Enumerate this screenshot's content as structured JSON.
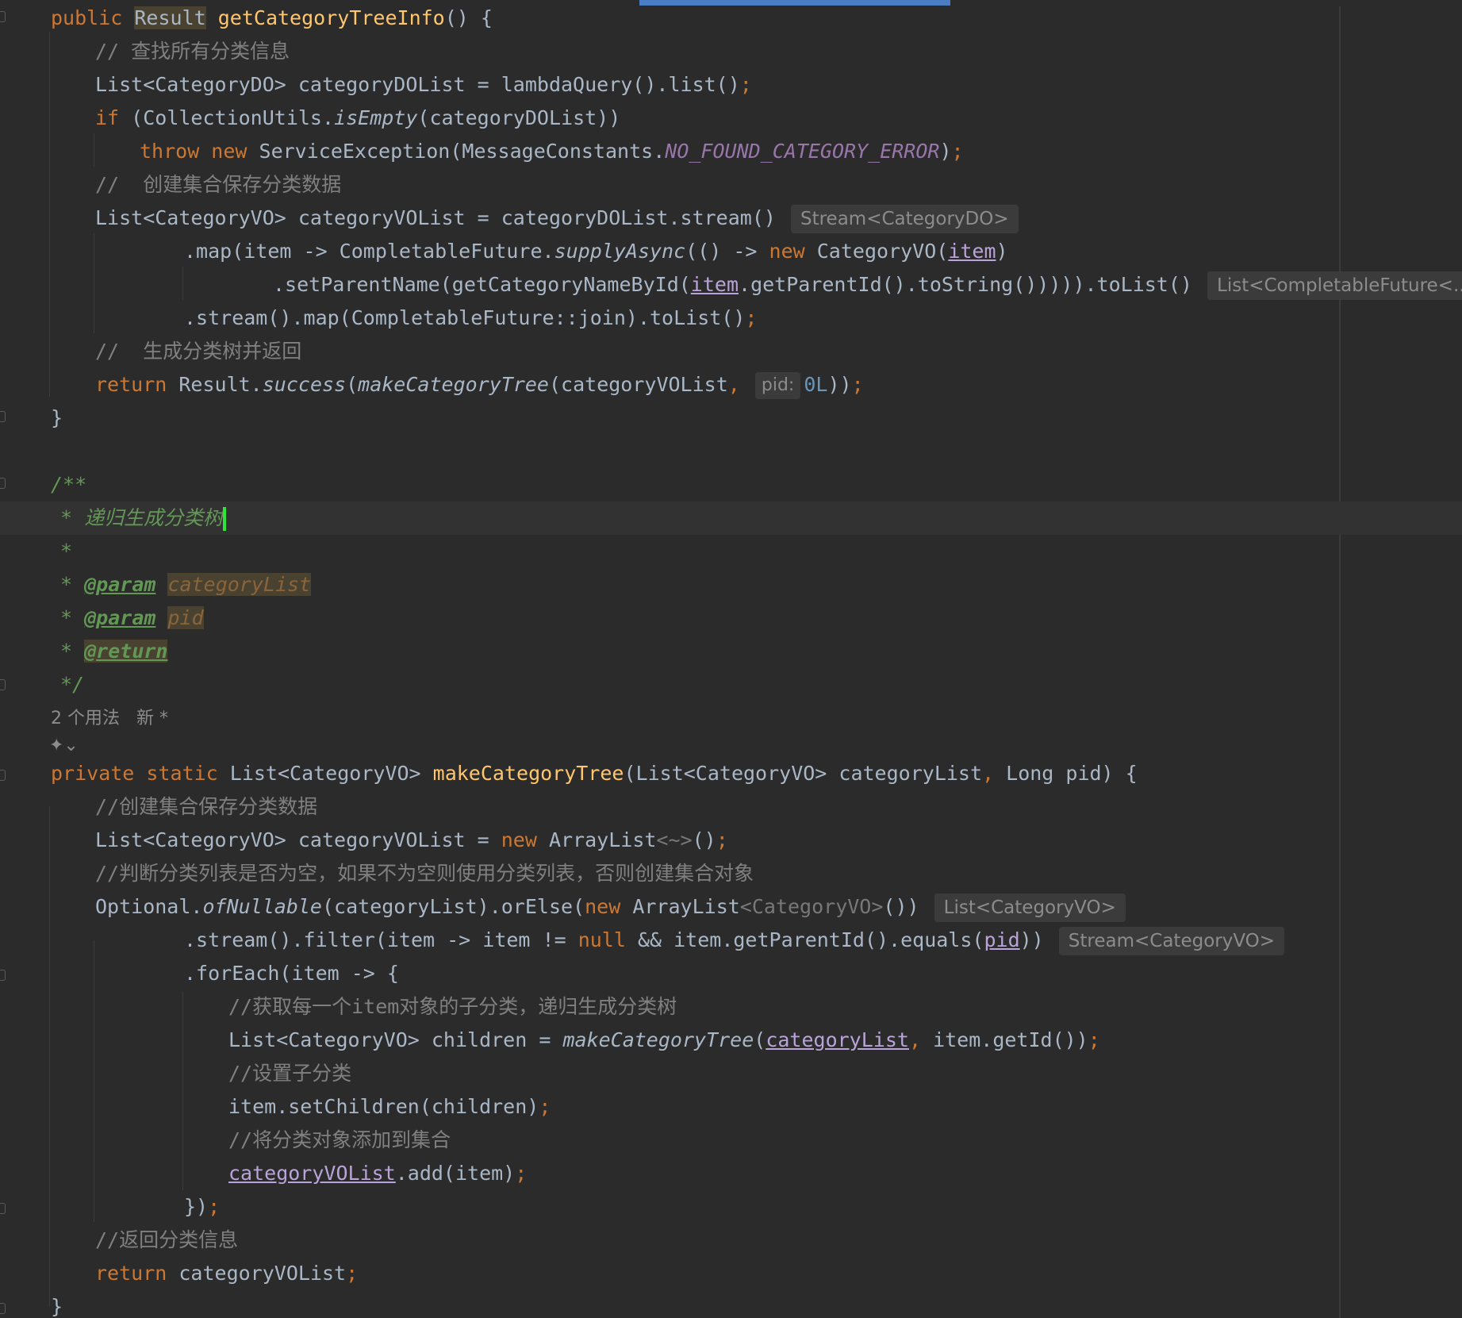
{
  "usage": {
    "label": "2 个用法   新 *"
  },
  "lines": [
    "public Result getCategoryTreeInfo() {",
    "// 查找所有分类信息",
    "List<CategoryDO> categoryDOList = lambdaQuery().list();",
    "if (CollectionUtils.isEmpty(categoryDOList))",
    "throw new ServiceException(MessageConstants.NO_FOUND_CATEGORY_ERROR);",
    "//  创建集合保存分类数据",
    "List<CategoryVO> categoryVOList = categoryDOList.stream()",
    ".map(item -> CompletableFuture.supplyAsync(() -> new CategoryVO(item)",
    ".setParentName(getCategoryNameById(item.getParentId().toString())))).toList()",
    ".stream().map(CompletableFuture::join).toList();",
    "//  生成分类树并返回",
    "return Result.success(makeCategoryTree(categoryVOList, 0L));",
    "}",
    "/**",
    "* 递归生成分类树",
    "*",
    "* @param categoryList",
    "* @param pid",
    "* @return",
    "*/",
    "private static List<CategoryVO> makeCategoryTree(List<CategoryVO> categoryList, Long pid) {",
    "//创建集合保存分类数据",
    "List<CategoryVO> categoryVOList = new ArrayList<~>();",
    "//判断分类列表是否为空，如果不为空则使用分类列表，否则创建集合对象",
    "Optional.ofNullable(categoryList).orElse(new ArrayList<CategoryVO>())",
    ".stream().filter(item -> item != null && item.getParentId().equals(pid))",
    ".forEach(item -> {",
    "//获取每一个item对象的子分类，递归生成分类树",
    "List<CategoryVO> children = makeCategoryTree(categoryList, item.getId());",
    "//设置子分类",
    "item.setChildren(children);",
    "//将分类对象添加到集合",
    "categoryVOList.add(item);",
    "});",
    "//返回分类信息",
    "return categoryVOList;",
    "}"
  ],
  "hints": {
    "stream_type": "Stream<CategoryDO>",
    "tolist_type": "List<CompletableFuture<...>>",
    "param_name": "pid:",
    "orelse_type": "List<CategoryVO>",
    "filter_type": "Stream<CategoryVO>"
  },
  "colors": {
    "background": "#2b2b2b",
    "keyword": "#cc7832",
    "function": "#ffc66d",
    "comment": "#808080",
    "doc": "#629755",
    "static_field": "#9876aa",
    "caret": "#2ee63a",
    "scrollbar": "#4a7dc4"
  }
}
